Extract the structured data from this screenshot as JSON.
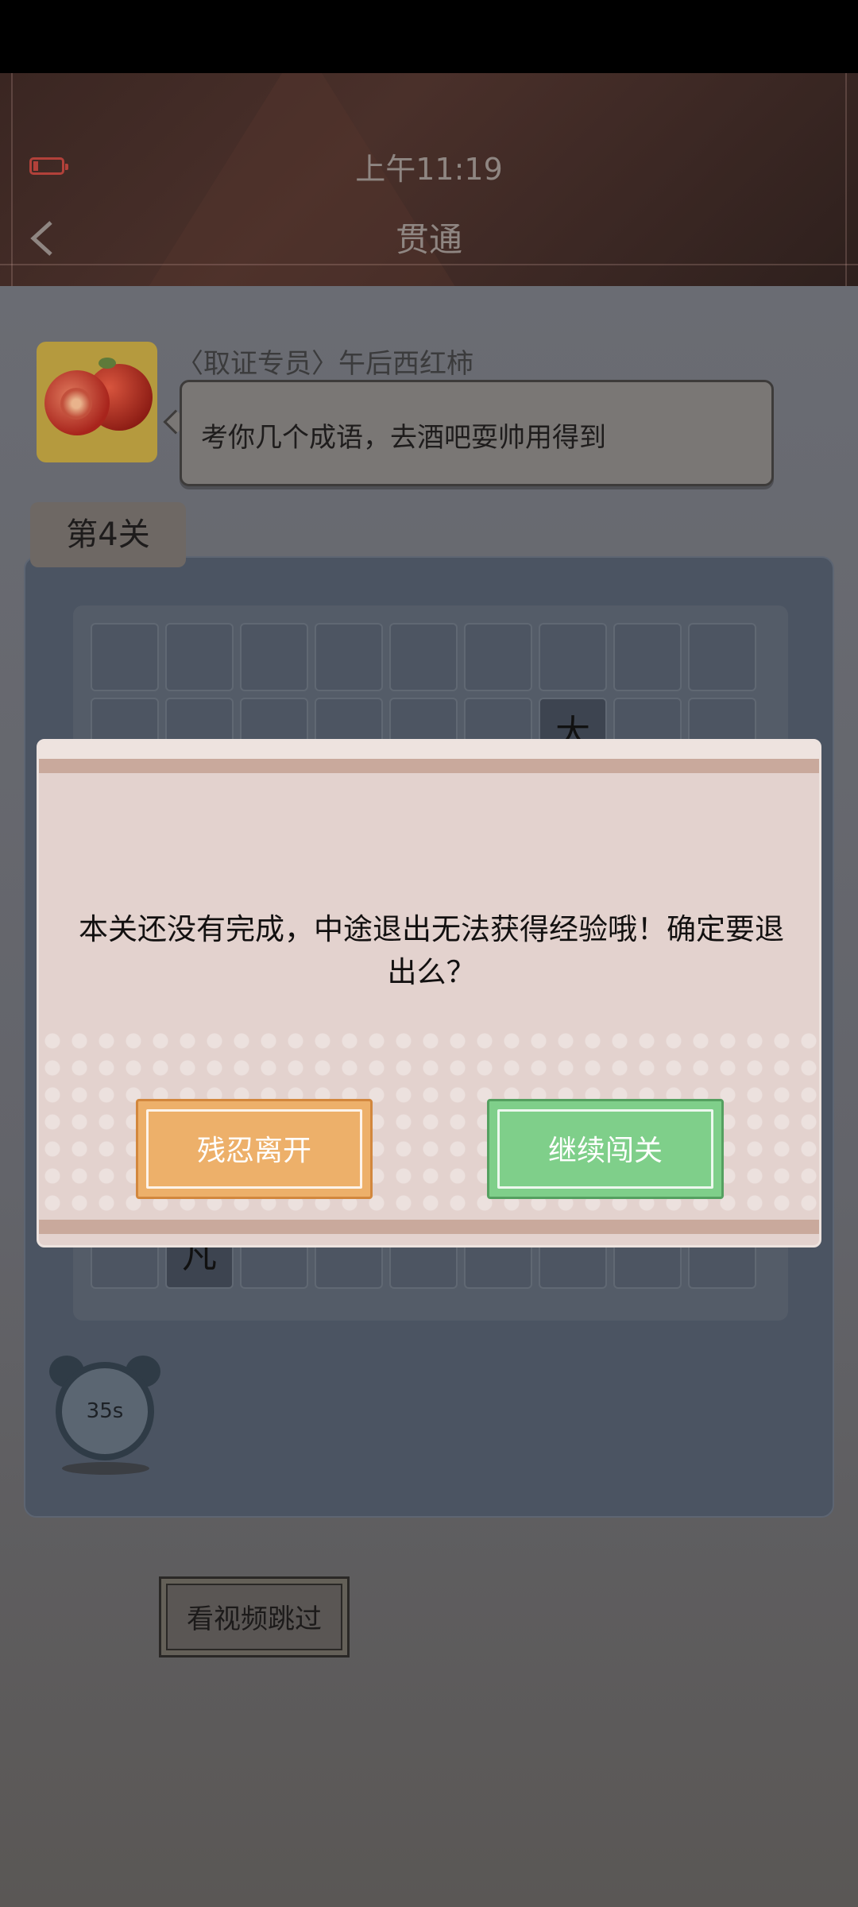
{
  "status_bar": {
    "time": "上午11:19"
  },
  "header": {
    "title": "贯通"
  },
  "npc": {
    "speaker": "〈取证专员〉午后西红柿",
    "message": "考你几个成语，去酒吧耍帅用得到"
  },
  "level": {
    "label": "第4关"
  },
  "grid": {
    "visible_chars": [
      "大",
      "凡"
    ]
  },
  "timer": {
    "label": "35s"
  },
  "skip_button": {
    "label": "看视频跳过"
  },
  "dialog": {
    "message": "本关还没有完成，中途退出无法获得经验哦！确定要退出么？",
    "leave_label": "残忍离开",
    "continue_label": "继续闯关"
  }
}
